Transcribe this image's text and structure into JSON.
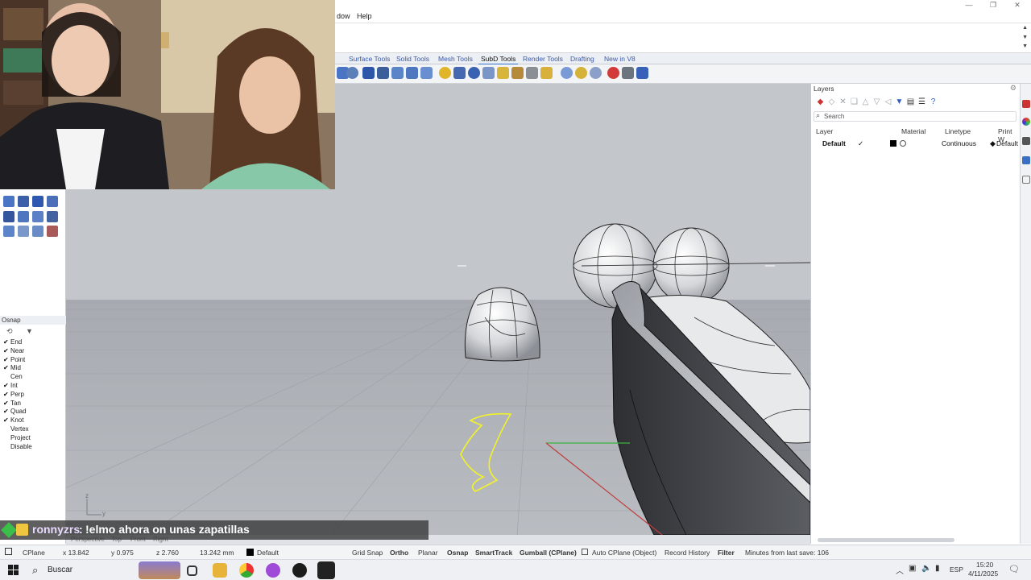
{
  "menu": {
    "window_partial": "dow",
    "help": "Help"
  },
  "window_controls": {
    "minimize": "—",
    "restore": "❐",
    "close": "✕"
  },
  "tabs": [
    {
      "label": "Surface Tools",
      "active": false
    },
    {
      "label": "Solid Tools",
      "active": false
    },
    {
      "label": "Mesh Tools",
      "active": false
    },
    {
      "label": "SubD Tools",
      "active": true
    },
    {
      "label": "Render Tools",
      "active": false
    },
    {
      "label": "Drafting",
      "active": false
    },
    {
      "label": "New in V8",
      "active": false
    }
  ],
  "osnap": {
    "title": "Osnap",
    "items": [
      {
        "label": "End",
        "checked": true
      },
      {
        "label": "Near",
        "checked": true
      },
      {
        "label": "Point",
        "checked": true
      },
      {
        "label": "Mid",
        "checked": true
      },
      {
        "label": "Cen",
        "checked": false
      },
      {
        "label": "Int",
        "checked": true
      },
      {
        "label": "Perp",
        "checked": true
      },
      {
        "label": "Tan",
        "checked": true
      },
      {
        "label": "Quad",
        "checked": true
      },
      {
        "label": "Knot",
        "checked": true
      },
      {
        "label": "Vertex",
        "checked": false
      },
      {
        "label": "Project",
        "checked": false
      },
      {
        "label": "Disable",
        "checked": false
      }
    ]
  },
  "layers": {
    "title": "Layers",
    "search_placeholder": "Search",
    "headers": {
      "layer": "Layer",
      "material": "Material",
      "linetype": "Linetype",
      "print": "Print W"
    },
    "rows": [
      {
        "name": "Default",
        "current": "✓",
        "linetype": "Continuous",
        "print": "Default"
      }
    ]
  },
  "viewport": {
    "axis_z": "z",
    "axis_y": "y",
    "view_tabs": [
      "Perspective",
      "Top",
      "Front",
      "Right"
    ]
  },
  "status": {
    "cplane": "CPlane",
    "x": "x 13.842",
    "y": "y 0.975",
    "z": "z 2.760",
    "dist": "13.242 mm",
    "layer": "Default",
    "grid_snap": "Grid Snap",
    "ortho": "Ortho",
    "planar": "Planar",
    "osnap": "Osnap",
    "smarttrack": "SmartTrack",
    "gumball": "Gumball (CPlane)",
    "auto_cplane": "Auto CPlane (Object)",
    "record_history": "Record History",
    "filter": "Filter",
    "minutes": "Minutes from last save: 106"
  },
  "chat": {
    "user": "ronnyzrs",
    "sep": ":",
    "message": "!elmo ahora on unas zapatillas"
  },
  "taskbar": {
    "search": "Buscar",
    "lang": "ESP",
    "time": "15:20",
    "date": "4/11/2025"
  },
  "colors": {
    "viewport_bg": "#c3c7cc",
    "curve": "#f2f227",
    "x_axis": "#c03c3c",
    "y_axis": "#3cb43c",
    "active_tab": "#2f6fc9"
  }
}
